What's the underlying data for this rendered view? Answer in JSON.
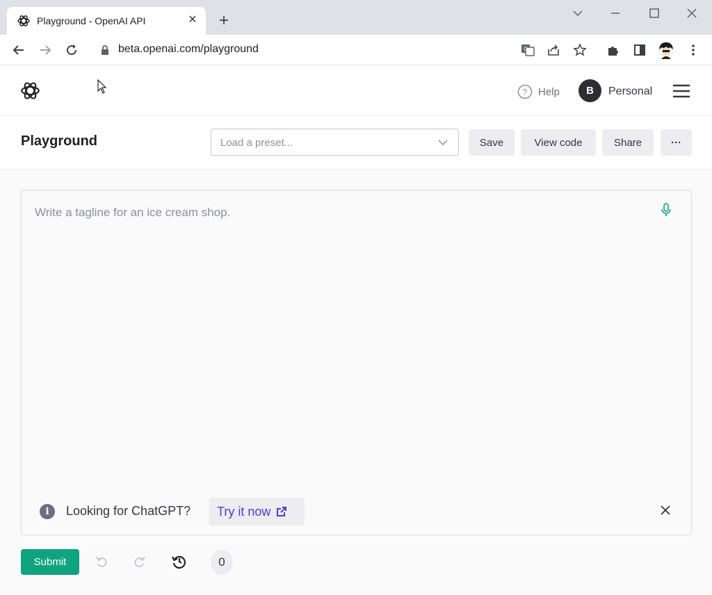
{
  "browser": {
    "tab": {
      "title": "Playground - OpenAI API",
      "favicon": "openai-logo-icon"
    },
    "url": "beta.openai.com/playground",
    "window_controls": [
      "chevron-down-icon",
      "minimize-icon",
      "maximize-icon",
      "close-icon"
    ],
    "toolbar_icons": [
      "back-icon",
      "forward-icon",
      "reload-icon",
      "lock-icon",
      "translate-icon",
      "share-icon",
      "star-icon",
      "extensions-icon",
      "sidepanel-icon",
      "profile-avatar",
      "kebab-menu-icon"
    ]
  },
  "header": {
    "help_label": "Help",
    "avatar_letter": "B",
    "org_label": "Personal"
  },
  "titlebar": {
    "title": "Playground",
    "preset_placeholder": "Load a preset...",
    "save_label": "Save",
    "view_code_label": "View code",
    "share_label": "Share",
    "more_label": "···"
  },
  "editor": {
    "placeholder": "Write a tagline for an ice cream shop.",
    "value": ""
  },
  "notice": {
    "text": "Looking for ChatGPT?",
    "try_label": "Try it now"
  },
  "actions": {
    "submit_label": "Submit",
    "token_count": "0"
  },
  "colors": {
    "accent": "#10a37f",
    "link": "#5436da",
    "surface": "#ececf1"
  }
}
